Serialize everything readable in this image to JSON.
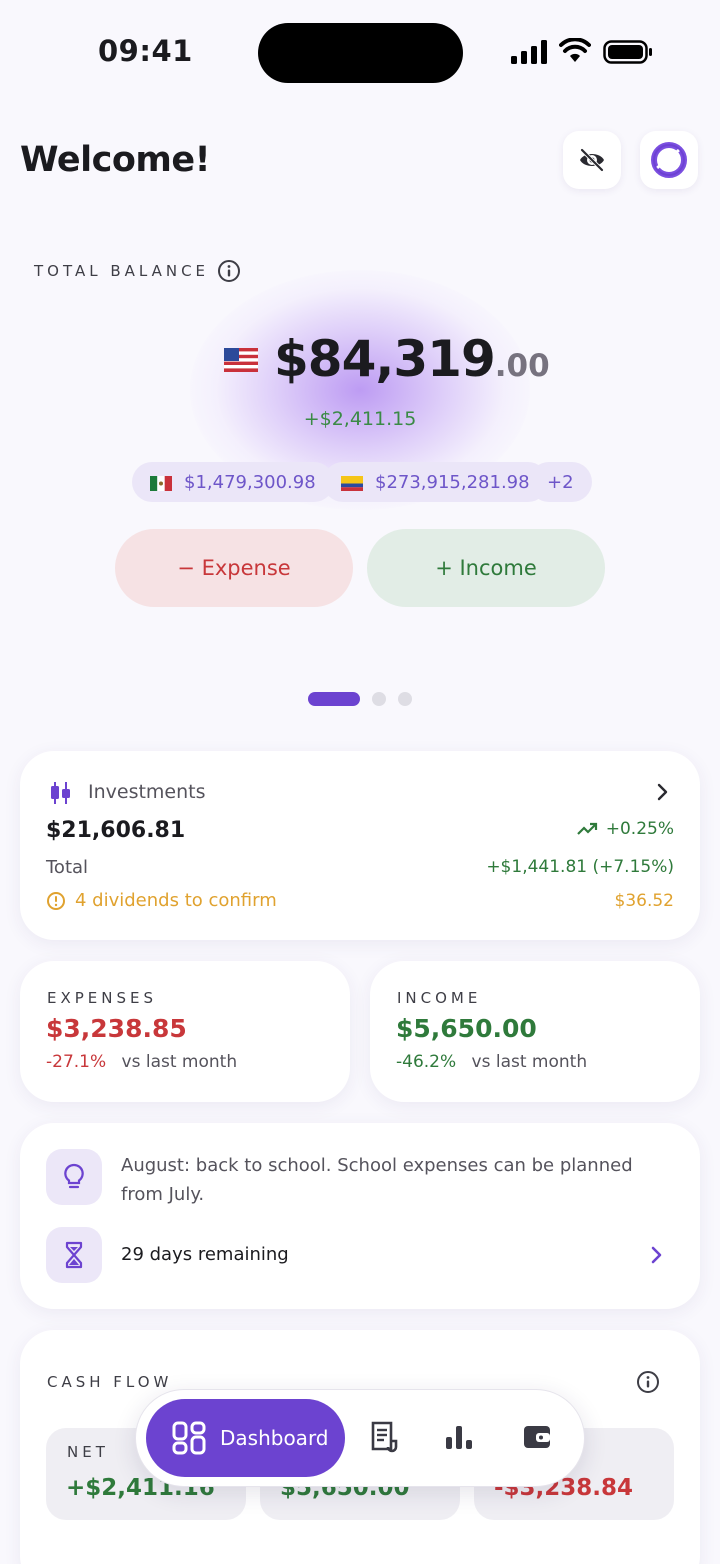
{
  "status_bar": {
    "time": "09:41"
  },
  "header": {
    "title": "Welcome!",
    "hide_icon": "eye-off-icon",
    "logo_icon": "app-logo-icon"
  },
  "balance": {
    "label": "TOTAL BALANCE",
    "main": "$84,319",
    "cents": ".00",
    "change": "+$2,411.15",
    "currencies": [
      {
        "flag": "mexico-flag-icon",
        "amount": "$1,479,300.98"
      },
      {
        "flag": "colombia-flag-icon",
        "amount": "$273,915,281.98"
      }
    ],
    "more_chip": "+2",
    "expense_button": "− Expense",
    "income_button": "+ Income",
    "pager": {
      "pages": 3,
      "active": 1
    }
  },
  "investments": {
    "title": "Investments",
    "amount": "$21,606.81",
    "total_label": "Total",
    "percent": "+0.25%",
    "gain": "+$1,441.81 (+7.15%)",
    "dividends": "4 dividends to confirm",
    "dividends_amount": "$36.52"
  },
  "expenses": {
    "label": "EXPENSES",
    "amount": "$3,238.85",
    "change": "-27.1%",
    "suffix": "vs last month"
  },
  "income": {
    "label": "INCOME",
    "amount": "$5,650.00",
    "change": "-46.2%",
    "suffix": "vs last month"
  },
  "tip": {
    "line1": "August: back to school. School expenses can be planned",
    "line2": "from July.",
    "remaining": "29 days remaining"
  },
  "cash_flow": {
    "label": "CASH FLOW",
    "net_label": "NET",
    "net": "+$2,411.16",
    "income": "$5,650.00",
    "expenses": "-$3,238.84"
  },
  "nav": {
    "dashboard": "Dashboard",
    "items": [
      "receipt-icon",
      "bar-chart-icon",
      "wallet-icon"
    ]
  },
  "colors": {
    "accent": "#6c43d0",
    "positive": "#2f7a3b",
    "negative": "#c8373a",
    "warning": "#e0a22f"
  }
}
